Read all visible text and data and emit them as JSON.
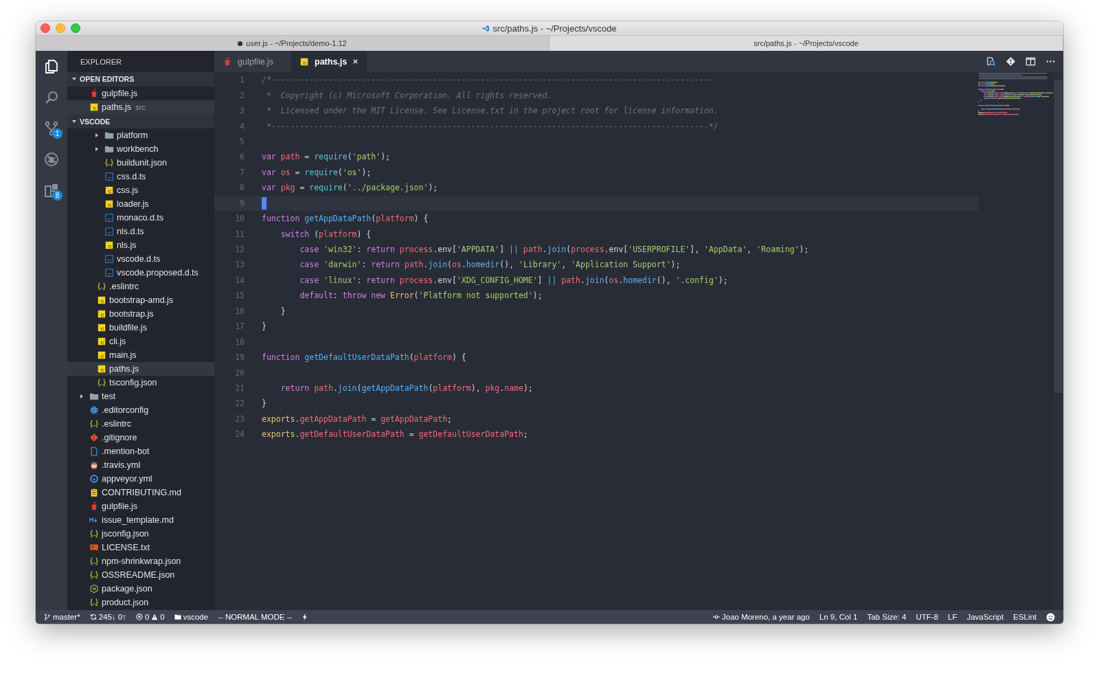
{
  "window": {
    "title": "src/paths.js - ~/Projects/vscode",
    "tabs": [
      {
        "label": "user.js - ~/Projects/demo-1.12",
        "dirty": true,
        "selected": false
      },
      {
        "label": "src/paths.js - ~/Projects/vscode",
        "dirty": false,
        "selected": true
      }
    ]
  },
  "activity_bar": [
    {
      "kind": "files",
      "selected": true
    },
    {
      "kind": "search",
      "selected": false
    },
    {
      "kind": "git",
      "badge": "1",
      "selected": false
    },
    {
      "kind": "debug",
      "selected": false
    },
    {
      "kind": "extensions",
      "badge": "8",
      "selected": false
    }
  ],
  "sidebar": {
    "title": "EXPLORER",
    "open_editors": {
      "title": "OPEN EDITORS",
      "expanded": true,
      "items": [
        {
          "name": "gulpfile.js",
          "kind": "gulp",
          "selected": false
        },
        {
          "name": "paths.js",
          "kind": "js",
          "description": "src",
          "selected": true
        }
      ]
    },
    "folder": {
      "title": "VSCODE",
      "expanded": true,
      "items": [
        {
          "children": [
            {
              "children": [
                {
                  "name": "platform",
                  "kind": "folder",
                  "expanded": false,
                  "selected": false
                },
                {
                  "name": "workbench",
                  "kind": "folder",
                  "expanded": false,
                  "selected": false
                },
                {
                  "name": "buildunit.json",
                  "kind": "json",
                  "selected": false
                },
                {
                  "name": "css.d.ts",
                  "kind": "ts",
                  "selected": false
                },
                {
                  "name": "css.js",
                  "kind": "js",
                  "selected": false
                },
                {
                  "name": "loader.js",
                  "kind": "js",
                  "selected": false
                },
                {
                  "name": "monaco.d.ts",
                  "kind": "ts",
                  "selected": false
                },
                {
                  "name": "nls.d.ts",
                  "kind": "ts",
                  "selected": false
                },
                {
                  "name": "nls.js",
                  "kind": "js",
                  "selected": false
                },
                {
                  "name": "vscode.d.ts",
                  "kind": "ts",
                  "selected": false
                },
                {
                  "name": "vscode.proposed.d.ts",
                  "kind": "ts",
                  "selected": false
                }
              ]
            },
            {
              "name": ".eslintrc",
              "kind": "json",
              "selected": false
            },
            {
              "name": "bootstrap-amd.js",
              "kind": "js",
              "selected": false
            },
            {
              "name": "bootstrap.js",
              "kind": "js",
              "selected": false
            },
            {
              "name": "buildfile.js",
              "kind": "js",
              "selected": false
            },
            {
              "name": "cli.js",
              "kind": "js",
              "selected": false
            },
            {
              "name": "main.js",
              "kind": "js",
              "selected": false
            },
            {
              "name": "paths.js",
              "kind": "js",
              "selected": true
            },
            {
              "name": "tsconfig.json",
              "kind": "json",
              "selected": false
            }
          ]
        },
        {
          "name": "test",
          "kind": "folder",
          "expanded": false,
          "selected": false
        },
        {
          "name": ".editorconfig",
          "kind": "gear",
          "selected": false
        },
        {
          "name": ".eslintrc",
          "kind": "json",
          "selected": false
        },
        {
          "name": ".gitignore",
          "kind": "git",
          "selected": false
        },
        {
          "name": ".mention-bot",
          "kind": "file",
          "selected": false
        },
        {
          "name": ".travis.yml",
          "kind": "travis",
          "selected": false
        },
        {
          "name": "appveyor.yml",
          "kind": "appveyor",
          "selected": false
        },
        {
          "name": "CONTRIBUTING.md",
          "kind": "clipboard",
          "selected": false
        },
        {
          "name": "gulpfile.js",
          "kind": "gulp",
          "selected": false
        },
        {
          "name": "issue_template.md",
          "kind": "markdown",
          "selected": false
        },
        {
          "name": "jsconfig.json",
          "kind": "json",
          "selected": false
        },
        {
          "name": "LICENSE.txt",
          "kind": "license",
          "selected": false
        },
        {
          "name": "npm-shrinkwrap.json",
          "kind": "json",
          "selected": false
        },
        {
          "name": "OSSREADME.json",
          "kind": "json",
          "selected": false
        },
        {
          "name": "package.json",
          "kind": "node",
          "selected": false
        },
        {
          "name": "product.json",
          "kind": "json",
          "selected": false
        }
      ]
    }
  },
  "editor": {
    "tabs": [
      {
        "label": "gulpfile.js",
        "kind": "gulp",
        "selected": false
      },
      {
        "label": "paths.js",
        "kind": "js",
        "selected": true
      }
    ],
    "lines": [
      {
        "number": "1",
        "current": false,
        "tokens": [
          {
            "t": "/*---------------------------------------------------------------------------------------------",
            "kind": "comment"
          }
        ]
      },
      {
        "number": "2",
        "current": false,
        "tokens": [
          {
            "t": " *  Copyright (c) Microsoft Corporation. All rights reserved.",
            "kind": "comment"
          }
        ]
      },
      {
        "number": "3",
        "current": false,
        "tokens": [
          {
            "t": " *  Licensed under the MIT License. See License.txt in the project root for license information.",
            "kind": "comment"
          }
        ]
      },
      {
        "number": "4",
        "current": false,
        "tokens": [
          {
            "t": " *--------------------------------------------------------------------------------------------*/",
            "kind": "comment"
          }
        ]
      },
      {
        "number": "5",
        "current": false
      },
      {
        "number": "6",
        "current": false,
        "tokens": [
          {
            "t": "var ",
            "kind": "keyword"
          },
          {
            "t": "path",
            "kind": "variable"
          },
          {
            "t": " = ",
            "kind": "plain"
          },
          {
            "t": "require",
            "kind": "builtin"
          },
          {
            "t": "(",
            "kind": "plain"
          },
          {
            "t": "'path'",
            "kind": "string"
          },
          {
            "t": ");",
            "kind": "plain"
          }
        ]
      },
      {
        "number": "7",
        "current": false,
        "tokens": [
          {
            "t": "var ",
            "kind": "keyword"
          },
          {
            "t": "os",
            "kind": "variable"
          },
          {
            "t": " = ",
            "kind": "plain"
          },
          {
            "t": "require",
            "kind": "builtin"
          },
          {
            "t": "(",
            "kind": "plain"
          },
          {
            "t": "'os'",
            "kind": "string"
          },
          {
            "t": ");",
            "kind": "plain"
          }
        ]
      },
      {
        "number": "8",
        "current": false,
        "tokens": [
          {
            "t": "var ",
            "kind": "keyword"
          },
          {
            "t": "pkg",
            "kind": "variable"
          },
          {
            "t": " = ",
            "kind": "plain"
          },
          {
            "t": "require",
            "kind": "builtin"
          },
          {
            "t": "(",
            "kind": "plain"
          },
          {
            "t": "'../package.json'",
            "kind": "string"
          },
          {
            "t": ");",
            "kind": "plain"
          }
        ]
      },
      {
        "number": "9",
        "current": true
      },
      {
        "number": "10",
        "current": false,
        "tokens": [
          {
            "t": "function ",
            "kind": "keyword"
          },
          {
            "t": "getAppDataPath",
            "kind": "function"
          },
          {
            "t": "(",
            "kind": "plain"
          },
          {
            "t": "platform",
            "kind": "variable"
          },
          {
            "t": ") {",
            "kind": "plain"
          }
        ]
      },
      {
        "number": "11",
        "current": false,
        "tokens": [
          {
            "t": "    switch",
            "kind": "keyword"
          },
          {
            "t": " (",
            "kind": "plain"
          },
          {
            "t": "platform",
            "kind": "variable"
          },
          {
            "t": ") {",
            "kind": "plain"
          }
        ]
      },
      {
        "number": "12",
        "current": false,
        "tokens": [
          {
            "t": "        case ",
            "kind": "keyword"
          },
          {
            "t": "'win32'",
            "kind": "string"
          },
          {
            "t": ": ",
            "kind": "plain"
          },
          {
            "t": "return ",
            "kind": "keyword"
          },
          {
            "t": "process",
            "kind": "variable"
          },
          {
            "t": ".env[",
            "kind": "plain"
          },
          {
            "t": "'APPDATA'",
            "kind": "string"
          },
          {
            "t": "] ",
            "kind": "plain"
          },
          {
            "t": "|| ",
            "kind": "operator"
          },
          {
            "t": "path",
            "kind": "variable"
          },
          {
            "t": ".",
            "kind": "plain"
          },
          {
            "t": "join",
            "kind": "function"
          },
          {
            "t": "(",
            "kind": "plain"
          },
          {
            "t": "process",
            "kind": "variable"
          },
          {
            "t": ".env[",
            "kind": "plain"
          },
          {
            "t": "'USERPROFILE'",
            "kind": "string"
          },
          {
            "t": "], ",
            "kind": "plain"
          },
          {
            "t": "'AppData'",
            "kind": "string"
          },
          {
            "t": ", ",
            "kind": "plain"
          },
          {
            "t": "'Roaming'",
            "kind": "string"
          },
          {
            "t": ");",
            "kind": "plain"
          }
        ]
      },
      {
        "number": "13",
        "current": false,
        "tokens": [
          {
            "t": "        case ",
            "kind": "keyword"
          },
          {
            "t": "'darwin'",
            "kind": "string"
          },
          {
            "t": ": ",
            "kind": "plain"
          },
          {
            "t": "return ",
            "kind": "keyword"
          },
          {
            "t": "path",
            "kind": "variable"
          },
          {
            "t": ".",
            "kind": "plain"
          },
          {
            "t": "join",
            "kind": "function"
          },
          {
            "t": "(",
            "kind": "plain"
          },
          {
            "t": "os",
            "kind": "variable"
          },
          {
            "t": ".",
            "kind": "plain"
          },
          {
            "t": "homedir",
            "kind": "function"
          },
          {
            "t": "(), ",
            "kind": "plain"
          },
          {
            "t": "'Library'",
            "kind": "string"
          },
          {
            "t": ", ",
            "kind": "plain"
          },
          {
            "t": "'Application Support'",
            "kind": "string"
          },
          {
            "t": ");",
            "kind": "plain"
          }
        ]
      },
      {
        "number": "14",
        "current": false,
        "tokens": [
          {
            "t": "        case ",
            "kind": "keyword"
          },
          {
            "t": "'linux'",
            "kind": "string"
          },
          {
            "t": ": ",
            "kind": "plain"
          },
          {
            "t": "return ",
            "kind": "keyword"
          },
          {
            "t": "process",
            "kind": "variable"
          },
          {
            "t": ".env[",
            "kind": "plain"
          },
          {
            "t": "'XDG_CONFIG_HOME'",
            "kind": "string"
          },
          {
            "t": "] ",
            "kind": "plain"
          },
          {
            "t": "|| ",
            "kind": "operator"
          },
          {
            "t": "path",
            "kind": "variable"
          },
          {
            "t": ".",
            "kind": "plain"
          },
          {
            "t": "join",
            "kind": "function"
          },
          {
            "t": "(",
            "kind": "plain"
          },
          {
            "t": "os",
            "kind": "variable"
          },
          {
            "t": ".",
            "kind": "plain"
          },
          {
            "t": "homedir",
            "kind": "function"
          },
          {
            "t": "(), ",
            "kind": "plain"
          },
          {
            "t": "'.config'",
            "kind": "string"
          },
          {
            "t": ");",
            "kind": "plain"
          }
        ]
      },
      {
        "number": "15",
        "current": false,
        "tokens": [
          {
            "t": "        default",
            "kind": "keyword"
          },
          {
            "t": ": ",
            "kind": "plain"
          },
          {
            "t": "throw new ",
            "kind": "keyword"
          },
          {
            "t": "Error",
            "kind": "class"
          },
          {
            "t": "(",
            "kind": "plain"
          },
          {
            "t": "'Platform not supported'",
            "kind": "string"
          },
          {
            "t": ");",
            "kind": "plain"
          }
        ]
      },
      {
        "number": "16",
        "current": false,
        "tokens": [
          {
            "t": "    }",
            "kind": "plain"
          }
        ]
      },
      {
        "number": "17",
        "current": false,
        "tokens": [
          {
            "t": "}",
            "kind": "plain"
          }
        ]
      },
      {
        "number": "18",
        "current": false
      },
      {
        "number": "19",
        "current": false,
        "tokens": [
          {
            "t": "function ",
            "kind": "keyword"
          },
          {
            "t": "getDefaultUserDataPath",
            "kind": "function"
          },
          {
            "t": "(",
            "kind": "plain"
          },
          {
            "t": "platform",
            "kind": "variable"
          },
          {
            "t": ") {",
            "kind": "plain"
          }
        ]
      },
      {
        "number": "20",
        "current": false
      },
      {
        "number": "21",
        "current": false,
        "tokens": [
          {
            "t": "    return ",
            "kind": "keyword"
          },
          {
            "t": "path",
            "kind": "variable"
          },
          {
            "t": ".",
            "kind": "plain"
          },
          {
            "t": "join",
            "kind": "function"
          },
          {
            "t": "(",
            "kind": "plain"
          },
          {
            "t": "getAppDataPath",
            "kind": "function"
          },
          {
            "t": "(",
            "kind": "plain"
          },
          {
            "t": "platform",
            "kind": "variable"
          },
          {
            "t": "), ",
            "kind": "plain"
          },
          {
            "t": "pkg",
            "kind": "variable"
          },
          {
            "t": ".",
            "kind": "plain"
          },
          {
            "t": "name",
            "kind": "variable"
          },
          {
            "t": ");",
            "kind": "plain"
          }
        ]
      },
      {
        "number": "22",
        "current": false,
        "tokens": [
          {
            "t": "}",
            "kind": "plain"
          }
        ]
      },
      {
        "number": "23",
        "current": false,
        "tokens": [
          {
            "t": "exports",
            "kind": "class"
          },
          {
            "t": ".",
            "kind": "plain"
          },
          {
            "t": "getAppDataPath",
            "kind": "variable"
          },
          {
            "t": " = ",
            "kind": "plain"
          },
          {
            "t": "getAppDataPath",
            "kind": "variable"
          },
          {
            "t": ";",
            "kind": "plain"
          }
        ]
      },
      {
        "number": "24",
        "current": false,
        "tokens": [
          {
            "t": "exports",
            "kind": "class"
          },
          {
            "t": ".",
            "kind": "plain"
          },
          {
            "t": "getDefaultUserDataPath",
            "kind": "variable"
          },
          {
            "t": " = ",
            "kind": "plain"
          },
          {
            "t": "getDefaultUserDataPath",
            "kind": "variable"
          },
          {
            "t": ";",
            "kind": "plain"
          }
        ]
      }
    ]
  },
  "status_bar": {
    "left": [
      {
        "kind": "branch",
        "text": "master*"
      },
      {
        "kind": "sync",
        "text": "245↓ 0↑"
      },
      {
        "kind": "problems",
        "errors": "0",
        "warnings": "0"
      },
      {
        "kind": "folder",
        "text": "vscode"
      },
      {
        "kind": "text",
        "text": "-- NORMAL MODE --"
      },
      {
        "kind": "lightning"
      }
    ],
    "right": [
      {
        "kind": "commit",
        "text": "Joao Moreno, a year ago"
      },
      {
        "kind": "text",
        "text": "Ln 9, Col 1"
      },
      {
        "kind": "text",
        "text": "Tab Size: 4"
      },
      {
        "kind": "text",
        "text": "UTF-8"
      },
      {
        "kind": "text",
        "text": "LF"
      },
      {
        "kind": "text",
        "text": "JavaScript"
      },
      {
        "kind": "text",
        "text": "ESLint"
      },
      {
        "kind": "smiley"
      }
    ]
  }
}
